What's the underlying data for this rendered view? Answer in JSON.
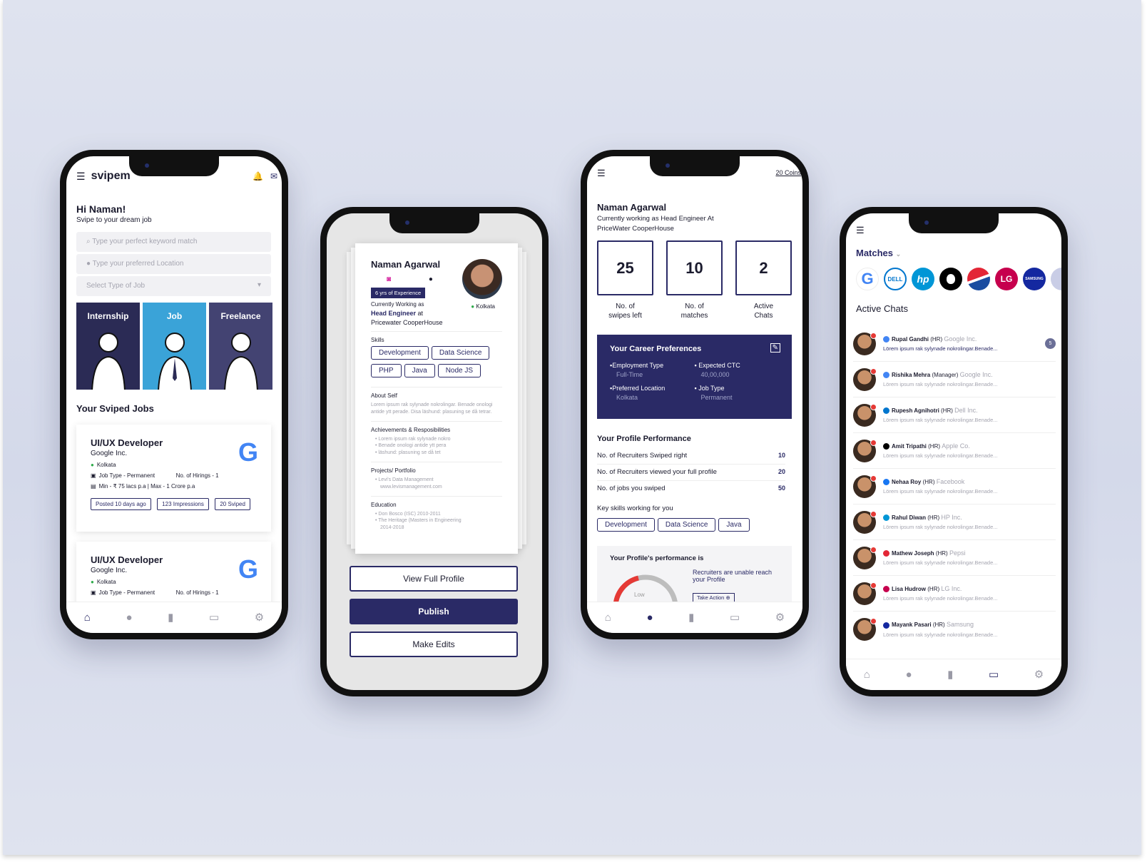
{
  "home": {
    "brand": "svipem",
    "greeting": "Hi Naman!",
    "subtitle": "Svipe to your dream job",
    "keyword_placeholder": "Type your perfect keyword match",
    "location_placeholder": "Type your preferred Location",
    "job_type_select": "Select Type of Job",
    "categories": [
      "Internship",
      "Job",
      "Freelance"
    ],
    "section_title": "Your Sviped Jobs",
    "jobs": [
      {
        "title": "UI/UX Developer",
        "company": "Google Inc.",
        "location": "Kolkata",
        "type": "Job Type - Permanent",
        "hirings": "No. of Hirings - 1",
        "salary": "Min - ₹ 75 lacs p.a | Max - 1 Crore p.a",
        "posted": "Posted 10 days ago",
        "impressions": "123 Impressions",
        "sviped": "20 Sviped"
      },
      {
        "title": "UI/UX Developer",
        "company": "Google Inc.",
        "location": "Kolkata",
        "type": "Job Type - Permanent",
        "hirings": "No. of Hirings - 1"
      }
    ]
  },
  "profile_card": {
    "name": "Naman Agarwal",
    "experience": "6 yrs of Experience",
    "location": "Kolkata",
    "working_label": "Currently Working as",
    "role": "Head Engineer",
    "at": "at",
    "employer": "Pricewater CooperHouse",
    "skills_label": "Skills",
    "skills": [
      "Development",
      "Data Science",
      "PHP",
      "Java",
      "Node JS"
    ],
    "about_label": "About Self",
    "about_text": "Lorem ipsum rak sylynade nokrolingar. Benade onologi antide ytt perade. Disa läshund: plasuning se då tetrar.",
    "achievements_label": "Achievements & Resposibilities",
    "achievements": [
      "Lorem ipsum rak sylynade nokro",
      "Benade onologi antide ytt pera",
      "läshund: plasuning se då tet"
    ],
    "projects_label": "Projects/ Portfolio",
    "projects": [
      "Levi's Data Management",
      "www.levismanagement.com"
    ],
    "education_label": "Education",
    "education": [
      "Don Bosco (ISC) 2010-2011",
      "The Heritage (Masters in Engineering",
      "2014-2018"
    ],
    "btn_view": "View Full Profile",
    "btn_publish": "Publish",
    "btn_edit": "Make Edits"
  },
  "dashboard": {
    "coins": "20 Coins",
    "name": "Naman Agarwal",
    "tagline": "Currently working as Head Engineer At PriceWater CooperHouse",
    "stats": [
      {
        "value": "25",
        "label": "No. of swipes left"
      },
      {
        "value": "10",
        "label": "No. of matches"
      },
      {
        "value": "2",
        "label": "Active Chats"
      }
    ],
    "prefs_title": "Your Career Preferences",
    "prefs": [
      {
        "label": "Employment Type",
        "value": "Full-Time"
      },
      {
        "label": "Expected CTC",
        "value": "40,00,000"
      },
      {
        "label": "Preferred Location",
        "value": "Kolkata"
      },
      {
        "label": "Job Type",
        "value": "Permanent"
      }
    ],
    "perf_title": "Your Profile Performance",
    "perf_rows": [
      {
        "label": "No. of Recruiters Swiped right",
        "value": "10"
      },
      {
        "label": "No. of Recruiters viewed your full profile",
        "value": "20"
      },
      {
        "label": "No. of jobs you swiped",
        "value": "50"
      }
    ],
    "key_skills_label": "Key skills working for you",
    "key_skills": [
      "Development",
      "Data Science",
      "Java"
    ],
    "performance_is": "Your Profile's performance is",
    "gauge_label": "Low",
    "recruiters_note": "Recruiters are unable reach your Profile",
    "take_action": "Take Action"
  },
  "matches": {
    "title": "Matches",
    "logos": [
      {
        "text": "G",
        "color": "#ffffff",
        "fg": "#4285F4"
      },
      {
        "text": "DELL",
        "color": "#ffffff",
        "fg": "#0076ce"
      },
      {
        "text": "hp",
        "color": "#0096d6",
        "fg": "#ffffff"
      },
      {
        "text": "",
        "color": "#000000",
        "fg": "#ffffff"
      },
      {
        "text": "",
        "color": "#e32636",
        "fg": "#ffffff"
      },
      {
        "text": "LG",
        "color": "#c6004d",
        "fg": "#ffffff"
      },
      {
        "text": "SAMSUNG",
        "color": "#1428a0",
        "fg": "#ffffff"
      }
    ],
    "active_title": "Active Chats",
    "unread": "5",
    "chats": [
      {
        "name": "Rupal Gandhi",
        "role": "(HR)",
        "company": "Google Inc.",
        "msg": "Lörem ipsum rak sylynade nokrolingar.Benade...",
        "dot": "#4285F4"
      },
      {
        "name": "Rishika Mehra",
        "role": "(Manager)",
        "company": "Google Inc.",
        "msg": "Lörem ipsum rak sylynade nokrolingar.Benade...",
        "dot": "#4285F4"
      },
      {
        "name": "Rupesh Agnihotri",
        "role": "(HR)",
        "company": "Dell Inc.",
        "msg": "Lörem ipsum rak sylynade nokrolingar.Benade...",
        "dot": "#0076ce"
      },
      {
        "name": "Amit Tripathi",
        "role": "(HR)",
        "company": "Apple Co.",
        "msg": "Lörem ipsum rak sylynade nokrolingar.Benade...",
        "dot": "#000000"
      },
      {
        "name": "Nehaa Roy",
        "role": "(HR)",
        "company": "Facebook",
        "msg": "Lörem ipsum rak sylynade nokrolingar.Benade...",
        "dot": "#1877f2"
      },
      {
        "name": "Rahul Diwan",
        "role": "(HR)",
        "company": "HP Inc.",
        "msg": "Lörem ipsum rak sylynade nokrolingar.Benade...",
        "dot": "#0096d6"
      },
      {
        "name": "Mathew Joseph",
        "role": "(HR)",
        "company": "Pepsi",
        "msg": "Lörem ipsum rak sylynade nokrolingar.Benade...",
        "dot": "#e32636"
      },
      {
        "name": "Lisa Hudrow",
        "role": "(HR)",
        "company": "LG Inc.",
        "msg": "Lörem ipsum rak sylynade nokrolingar.Benade...",
        "dot": "#c6004d"
      },
      {
        "name": "Mayank Pasari",
        "role": "(HR)",
        "company": "Samsung",
        "msg": "Lörem ipsum rak sylynade nokrolingar.Benade...",
        "dot": "#1428a0"
      }
    ]
  },
  "tab_icons": [
    "home-icon",
    "profile-icon",
    "swipe-icon",
    "chat-icon",
    "settings-icon"
  ],
  "colors": {
    "primary": "#2a2a66",
    "background": "#dfe3ef",
    "internship": "#2b2b55",
    "job": "#3aa3d8",
    "freelance": "#434372"
  }
}
